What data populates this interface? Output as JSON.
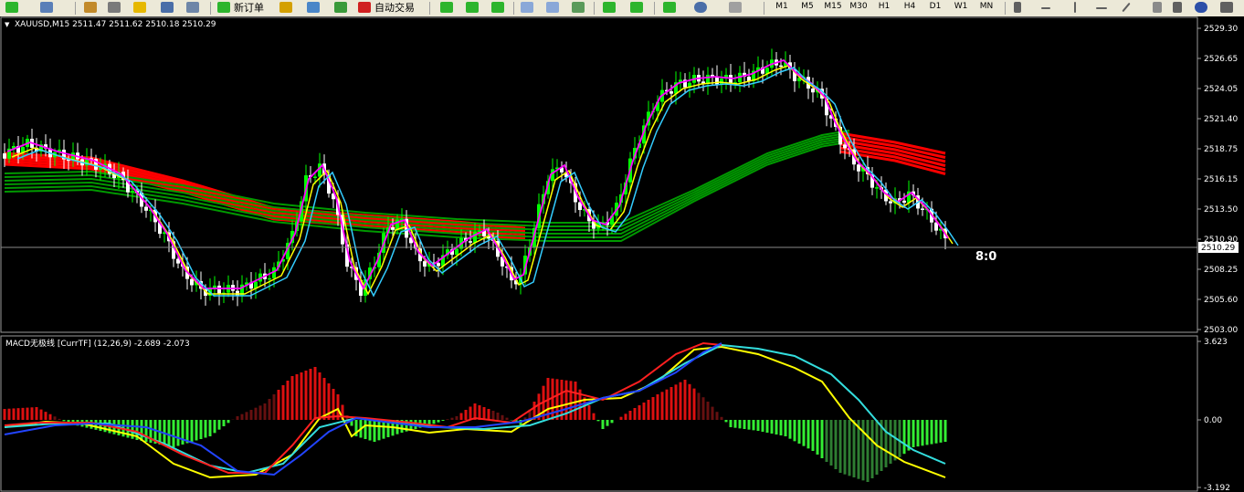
{
  "toolbar": {
    "new_order_label": "新订单",
    "autotrade_label": "自动交易",
    "timeframes": [
      "M1",
      "M5",
      "M15",
      "M30",
      "H1",
      "H4",
      "D1",
      "W1",
      "MN"
    ]
  },
  "main_chart": {
    "header": "XAUUSD,M15  2511.47 2511.62 2510.18 2510.29",
    "price_ticks": [
      "2529.30",
      "2526.65",
      "2524.05",
      "2521.40",
      "2518.75",
      "2516.15",
      "2513.50",
      "2510.90",
      "2508.25",
      "2505.60",
      "2503.00"
    ],
    "current_price": "2510.29",
    "score_text": "8:0"
  },
  "macd": {
    "header": "MACD无极线 [CurrTF] (12,26,9) -2.689 -2.073",
    "ticks": [
      "3.623",
      "0.00",
      "-3.192"
    ]
  },
  "colors": {
    "background": "#000000",
    "bull_candle": "#00ff00",
    "bear_candle": "#ffffff",
    "fast_ma": "#ffff00",
    "ma_pink": "#ff00ff",
    "ma_blue": "#33ccff",
    "ribbon_red": "#ff0000",
    "ribbon_green": "#009900",
    "macd_red": "#ff2020",
    "macd_blue": "#2244ff",
    "macd_cyan": "#33dddd",
    "macd_yellow": "#ffff00"
  },
  "icons": [
    "new-chart-icon",
    "profiles-icon",
    "crosshair-icon",
    "zoom-in-icon",
    "zoom-out-icon",
    "autotrade-icon",
    "period-icon",
    "template-icon",
    "cursor-icon",
    "line-icon"
  ]
}
